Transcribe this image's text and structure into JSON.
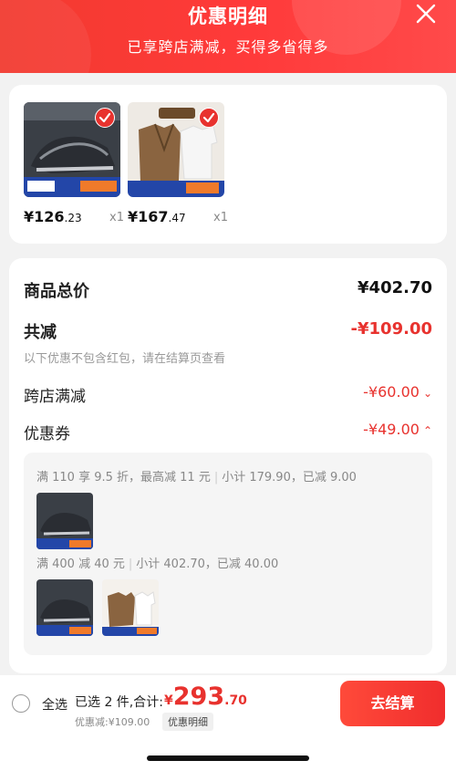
{
  "header": {
    "title": "优惠明细",
    "subtitle": "已享跨店满减，买得多省得多",
    "close_icon": "close-icon"
  },
  "products": [
    {
      "price_int": "¥126",
      "price_dec": ".23",
      "qty": "x1",
      "image": "sneaker",
      "selected": true
    },
    {
      "price_int": "¥167",
      "price_dec": ".47",
      "qty": "x1",
      "image": "jacket-and-tshirt",
      "selected": true
    }
  ],
  "summary": {
    "total_label": "商品总价",
    "total_value": "¥402.70",
    "reduce_label": "共减",
    "reduce_value": "-¥109.00",
    "note": "以下优惠不包含红包，请在结算页查看",
    "cross_store_label": "跨店满减",
    "cross_store_value": "-¥60.00",
    "coupon_label": "优惠券",
    "coupon_value": "-¥49.00"
  },
  "coupons": [
    {
      "rule": "满 110 享 9.5 折，最高减 11 元",
      "detail": "小计 179.90，已减 9.00",
      "images": [
        "sneaker"
      ]
    },
    {
      "rule": "满 400 减 40 元",
      "detail": "小计 402.70，已减 40.00",
      "images": [
        "sneaker",
        "jacket-and-tshirt"
      ]
    }
  ],
  "footer": {
    "select_all": "全选",
    "selected_text": "已选 2 件,合计:",
    "total_symbol": "¥",
    "total_int": "293",
    "total_dec": ".70",
    "discount_text": "优惠减:¥109.00",
    "detail_button": "优惠明细",
    "checkout_button": "去结算"
  },
  "colors": {
    "accent": "#e8322e",
    "header_gradient": "#f23a2f"
  }
}
